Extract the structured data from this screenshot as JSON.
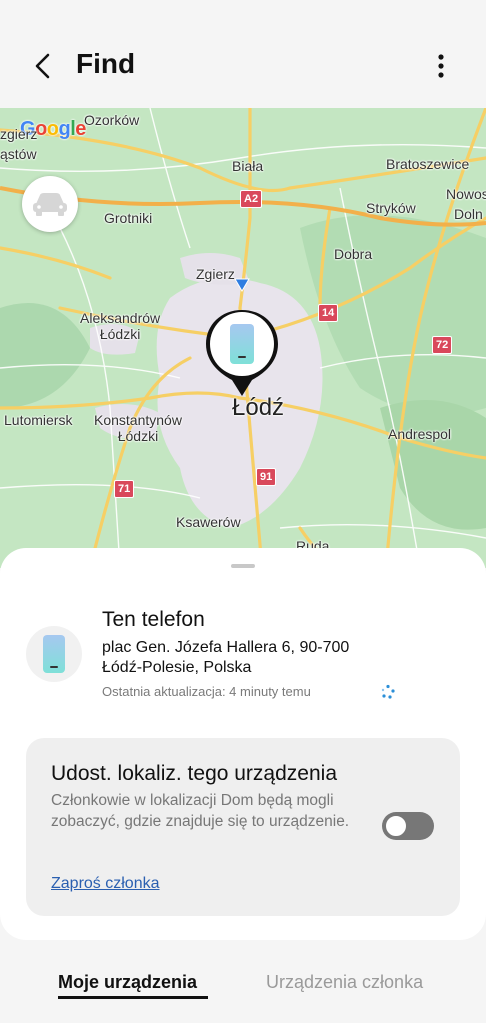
{
  "header": {
    "title": "Find",
    "back_icon": "chevron-left-icon",
    "more_icon": "more-vertical-icon"
  },
  "map": {
    "logo": "Google",
    "labels": {
      "ozorkow": "Ozorków",
      "zgierz_left": "zgierz",
      "stow": "ąstów",
      "biala": "Biała",
      "bratoszewice": "Bratoszewice",
      "nowost": "Nowost",
      "dolna": "Doln",
      "grotniki": "Grotniki",
      "strykow": "Stryków",
      "dobra": "Dobra",
      "zgierz": "Zgierz",
      "aleksandrow": "Aleksandrów\nŁódzki",
      "lodz": "Łódź",
      "lutomiersk": "Lutomiersk",
      "konstantynow": "Konstantynów\nŁódzki",
      "andrespol": "Andrespol",
      "ksawerow": "Ksawerów",
      "ruda": "Ruda"
    },
    "roads": {
      "a2": "A2",
      "r14": "14",
      "r72": "72",
      "r71": "71",
      "r91": "91"
    }
  },
  "device": {
    "name": "Ten telefon",
    "address_line1": "plac Gen. Józefa Hallera 6, 90-700",
    "address_line2": "Łódź-Polesie, Polska",
    "last_update": "Ostatnia aktualizacja: 4 minuty temu"
  },
  "share": {
    "title": "Udost. lokaliz. tego urządzenia",
    "description": "Członkowie w lokalizacji Dom będą mogli zobaczyć, gdzie znajduje się to urządzenie.",
    "toggle_on": false,
    "invite_label": "Zaproś członka"
  },
  "tabs": {
    "my_devices": "Moje urządzenia",
    "member_devices": "Urządzenia członka"
  },
  "colors": {
    "map_green": "#b9dfb9",
    "road_yellow": "#f6cf65",
    "road_badge": "#d9485b",
    "link": "#2a5fb0",
    "phone_gradient_top": "#a6c8f0",
    "phone_gradient_bottom": "#7fe0d8"
  }
}
